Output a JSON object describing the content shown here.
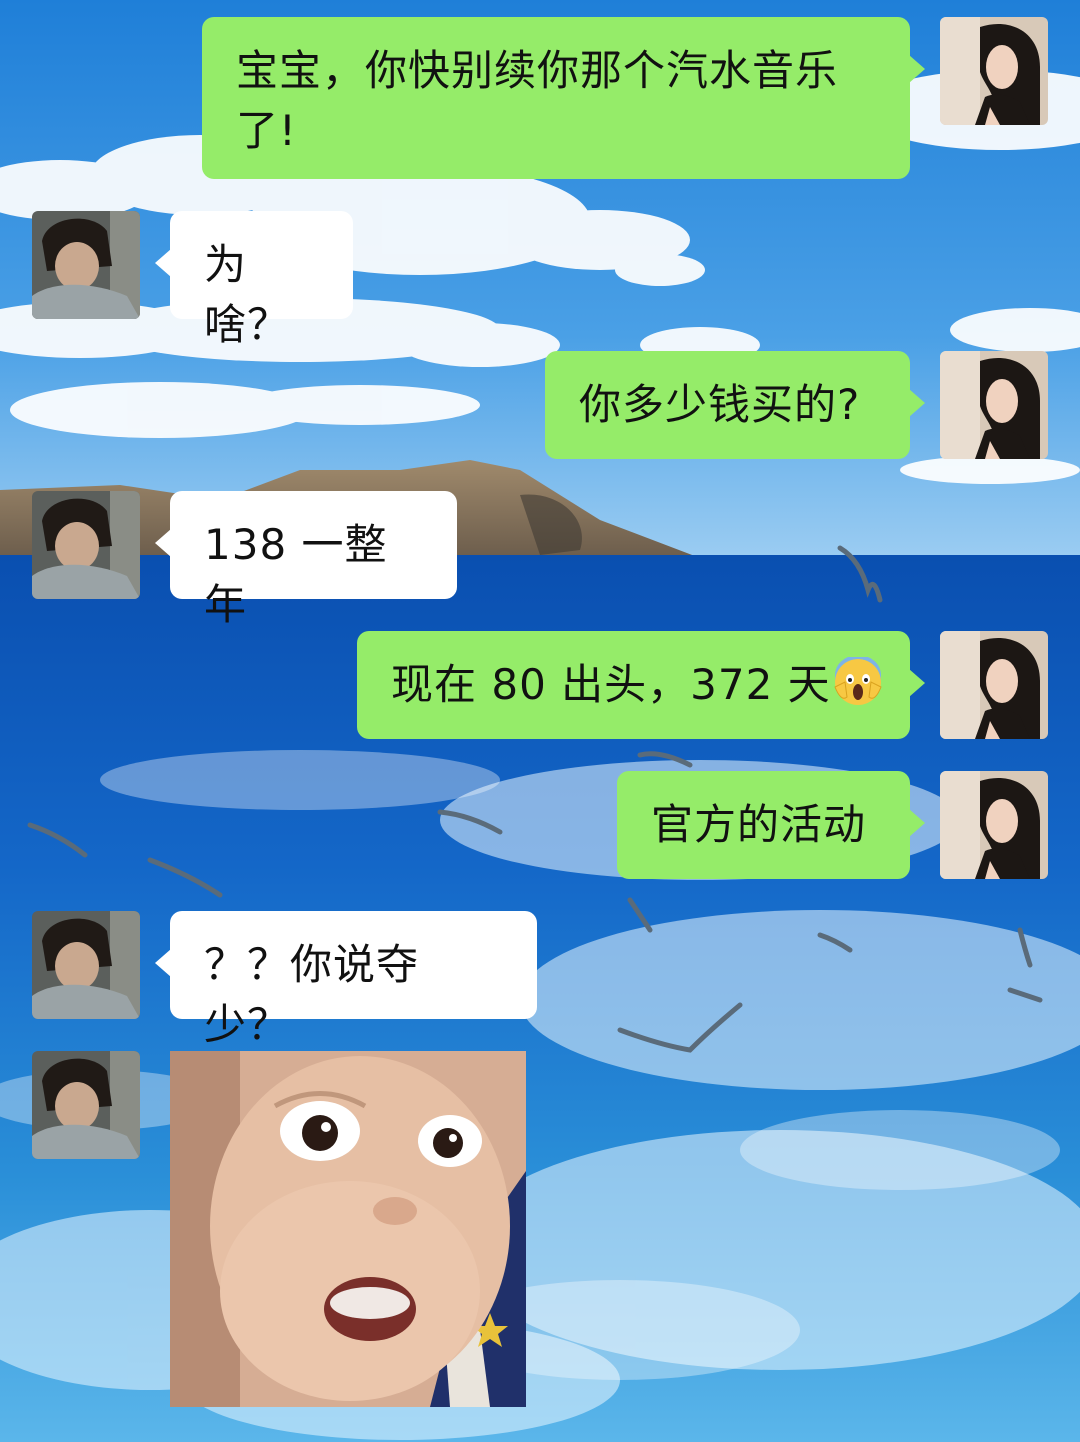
{
  "chat": {
    "messages": [
      {
        "sender": "me",
        "text": "宝宝，你快别续你那个汽水音乐了!"
      },
      {
        "sender": "other",
        "text": "为啥？"
      },
      {
        "sender": "me",
        "text": "你多少钱买的?"
      },
      {
        "sender": "other",
        "text": "138 一整年"
      },
      {
        "sender": "me",
        "text": "现在 80 出头，372 天",
        "emoji": "face-screaming-in-fear"
      },
      {
        "sender": "me",
        "text": "官方的活动"
      },
      {
        "sender": "other",
        "text": "？？你说夺少？"
      },
      {
        "sender": "other",
        "type": "sticker",
        "sticker": "surprised-baby-face"
      }
    ]
  },
  "colors": {
    "my_bubble": "#95EC69",
    "their_bubble": "#FFFFFF",
    "text": "#111111"
  }
}
